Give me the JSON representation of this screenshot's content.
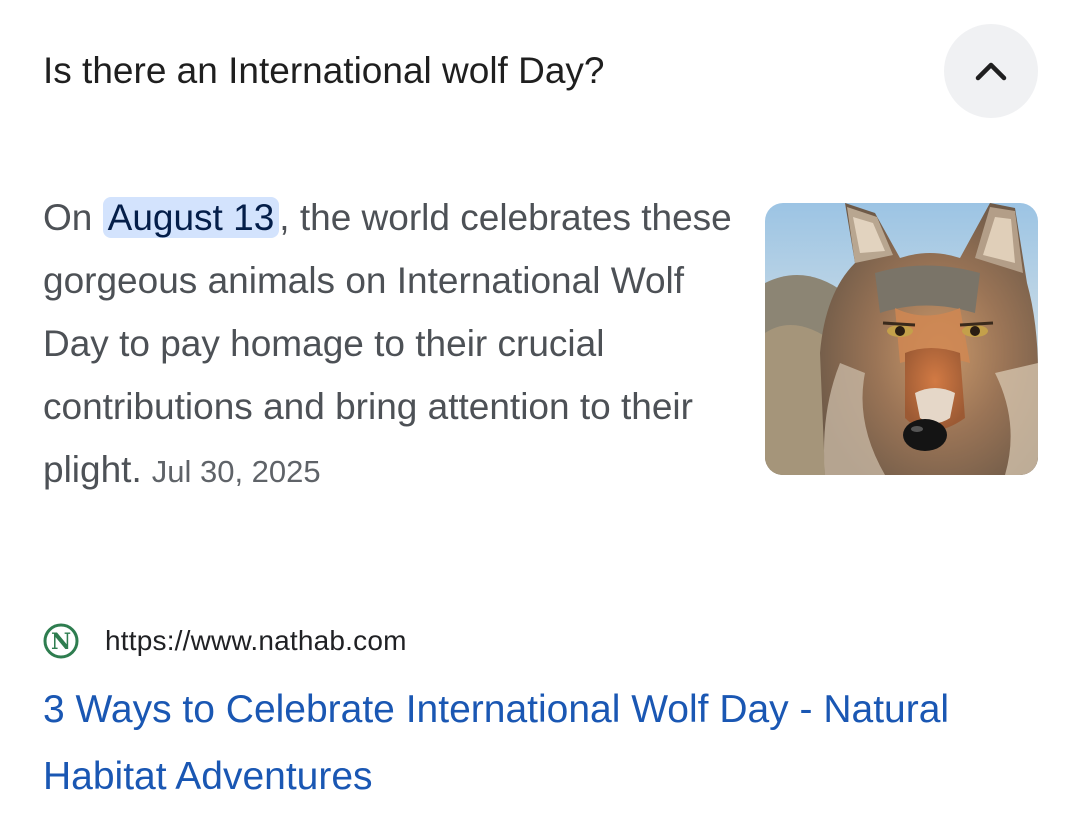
{
  "question": {
    "title": "Is there an International wolf Day?",
    "collapse_icon": "chevron-up-icon"
  },
  "answer": {
    "prefix": "On ",
    "highlight": "August 13",
    "body": ", the world celebrates these gorgeous animals on International Wolf Day to pay homage to their crucial contributions and bring attention to their plight.",
    "date": "Jul 30, 2025"
  },
  "thumbnail": {
    "subject": "wolf-portrait"
  },
  "source": {
    "url": "https://www.nathab.com",
    "favicon_letter": "N",
    "favicon_color": "#2e7d4f"
  },
  "result": {
    "title": "3 Ways to Celebrate International Wolf Day - Natural Habitat Adventures"
  },
  "colors": {
    "link": "#1a57b3",
    "highlight_bg": "#d3e3fd",
    "text_muted": "#4d5156"
  }
}
